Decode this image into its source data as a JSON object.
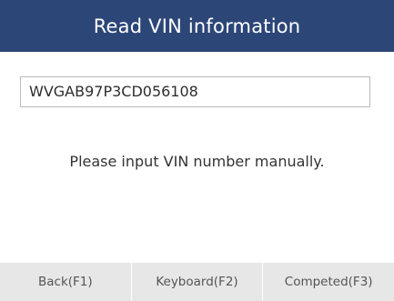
{
  "header": {
    "title": "Read VIN information"
  },
  "main": {
    "vin_value": "WVGAB97P3CD056108",
    "prompt": "Please input VIN number manually."
  },
  "footer": {
    "back_label": "Back(F1)",
    "keyboard_label": "Keyboard(F2)",
    "completed_label": "Competed(F3)"
  },
  "colors": {
    "header_background": "#2c4677",
    "footer_background": "#e7e7e7"
  }
}
